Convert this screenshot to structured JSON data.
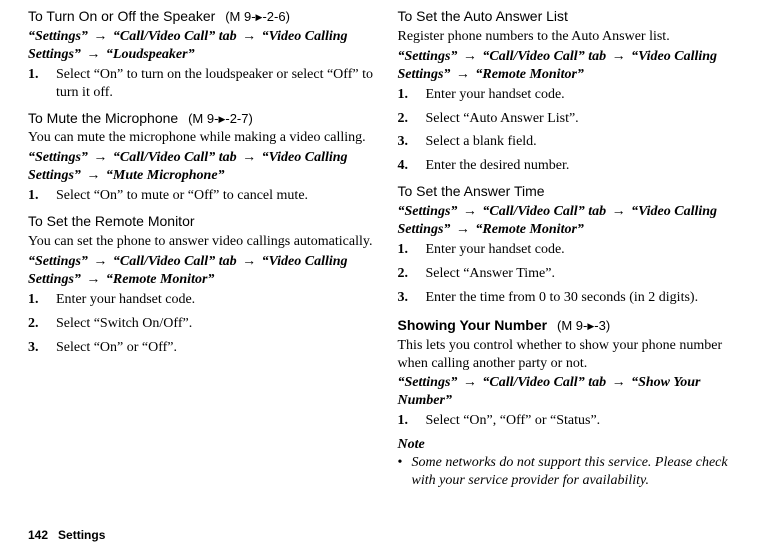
{
  "arrow": "→",
  "left": {
    "s1": {
      "head": "To Turn On or Off the Speaker",
      "ref_pre": "(M 9-",
      "ref_post": "-2-6)",
      "nav": "“Settings” → “Call/Video Call” tab → “Video Calling Settings” → “Loudspeaker”",
      "steps": [
        "Select “On” to turn on the loudspeaker or select “Off” to turn it off."
      ]
    },
    "s2": {
      "head": "To Mute the Microphone",
      "ref_pre": "(M 9-",
      "ref_post": "-2-7)",
      "body": "You can mute the microphone while making a video calling.",
      "nav": "“Settings” → “Call/Video Call” tab → “Video Calling Settings” → “Mute Microphone”",
      "steps": [
        "Select “On” to mute or “Off” to cancel mute."
      ]
    },
    "s3": {
      "head": "To Set the Remote Monitor",
      "body": "You can set the phone to answer video callings automatically.",
      "nav": "“Settings” → “Call/Video Call” tab → “Video Calling Settings” → “Remote Monitor”",
      "steps": [
        "Enter your handset code.",
        "Select “Switch On/Off”.",
        "Select “On” or “Off”."
      ]
    }
  },
  "right": {
    "s4": {
      "head": "To Set the Auto Answer List",
      "body": "Register phone numbers to the Auto Answer list.",
      "nav": "“Settings” → “Call/Video Call” tab → “Video Calling Settings” → “Remote Monitor”",
      "steps": [
        "Enter your handset code.",
        "Select “Auto Answer List”.",
        "Select a blank field.",
        "Enter the desired number."
      ]
    },
    "s5": {
      "head": "To Set the Answer Time",
      "nav": "“Settings” → “Call/Video Call” tab → “Video Calling Settings” → “Remote Monitor”",
      "steps": [
        "Enter your handset code.",
        "Select “Answer Time”.",
        "Enter the time from 0 to 30 seconds (in 2 digits)."
      ]
    },
    "s6": {
      "head": "Showing Your Number",
      "ref_pre": "(M 9-",
      "ref_post": "-3)",
      "body": "This lets you control whether to show your phone number when calling another party or not.",
      "nav": "“Settings” → “Call/Video Call” tab → “Show Your Number”",
      "steps": [
        "Select “On”, “Off” or “Status”."
      ]
    },
    "note": {
      "head": "Note",
      "body": "Some networks do not support this service. Please check with your service provider for availability."
    }
  },
  "footer": {
    "pagenum": "142",
    "section": "Settings"
  }
}
